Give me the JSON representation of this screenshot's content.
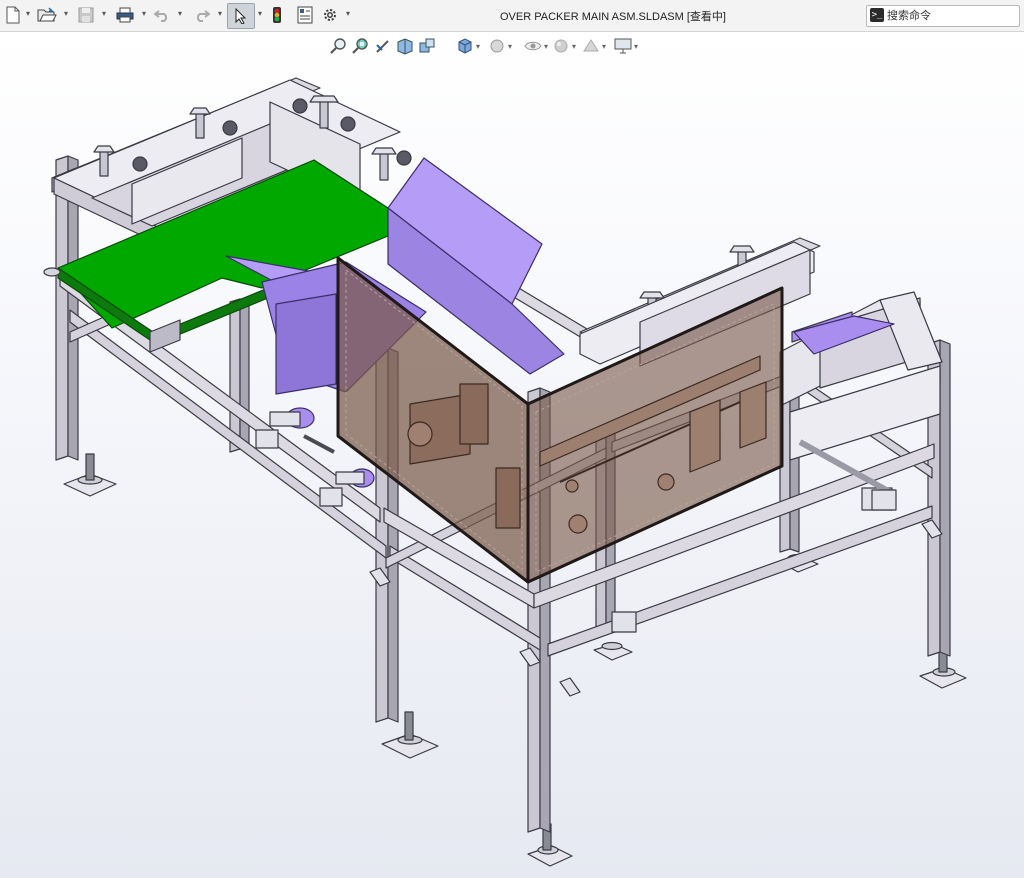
{
  "app": {
    "document_title": "OVER PACKER MAIN ASM.SLDASM [查看中]"
  },
  "toolbar": {
    "buttons": [
      {
        "name": "new-document",
        "icon": "new-document-icon",
        "dropdown": true
      },
      {
        "name": "open",
        "icon": "open-folder-icon",
        "dropdown": true
      },
      {
        "name": "save",
        "icon": "save-icon",
        "dropdown": true,
        "disabled": true
      },
      {
        "name": "print",
        "icon": "printer-icon",
        "dropdown": true
      },
      {
        "name": "undo",
        "icon": "undo-icon",
        "dropdown": true,
        "disabled": true
      },
      {
        "name": "redo",
        "icon": "redo-icon",
        "dropdown": true,
        "disabled": true
      },
      {
        "name": "select",
        "icon": "select-arrow-icon",
        "dropdown": true,
        "active": true
      },
      {
        "name": "rebuild",
        "icon": "traffic-light-icon",
        "dropdown": false
      },
      {
        "name": "file-properties",
        "icon": "file-properties-icon",
        "dropdown": false
      },
      {
        "name": "options",
        "icon": "gear-icon",
        "dropdown": true
      }
    ]
  },
  "search": {
    "icon": "command-prompt-icon",
    "placeholder": "搜索命令"
  },
  "heads_up_toolbar": {
    "tools": [
      {
        "name": "zoom-to-fit",
        "icon": "zoom-to-fit-icon"
      },
      {
        "name": "zoom-to-area",
        "icon": "zoom-area-icon"
      },
      {
        "name": "previous-view",
        "icon": "previous-view-icon"
      },
      {
        "name": "section-view",
        "icon": "section-view-icon"
      },
      {
        "name": "dynamic-annotation",
        "icon": "dynamic-view-icon"
      },
      {
        "name": "view-orientation",
        "icon": "view-orientation-icon",
        "dropdown": true
      },
      {
        "name": "display-style",
        "icon": "display-style-icon",
        "dropdown": true
      },
      {
        "name": "hide-show-items",
        "icon": "hide-show-icon",
        "dropdown": true
      },
      {
        "name": "edit-appearance",
        "icon": "appearance-icon",
        "dropdown": true
      },
      {
        "name": "apply-scene",
        "icon": "scene-icon",
        "dropdown": true
      },
      {
        "name": "view-settings",
        "icon": "monitor-icon",
        "dropdown": true
      }
    ]
  },
  "colors": {
    "frame_profile": "#c9c6d1",
    "frame_edge": "#3a3a44",
    "conveyor_belt": "#00a800",
    "guide_plates": "#a98ef0",
    "guard_window": "#7a5a4a",
    "title_bar": "#f3f3f3"
  }
}
